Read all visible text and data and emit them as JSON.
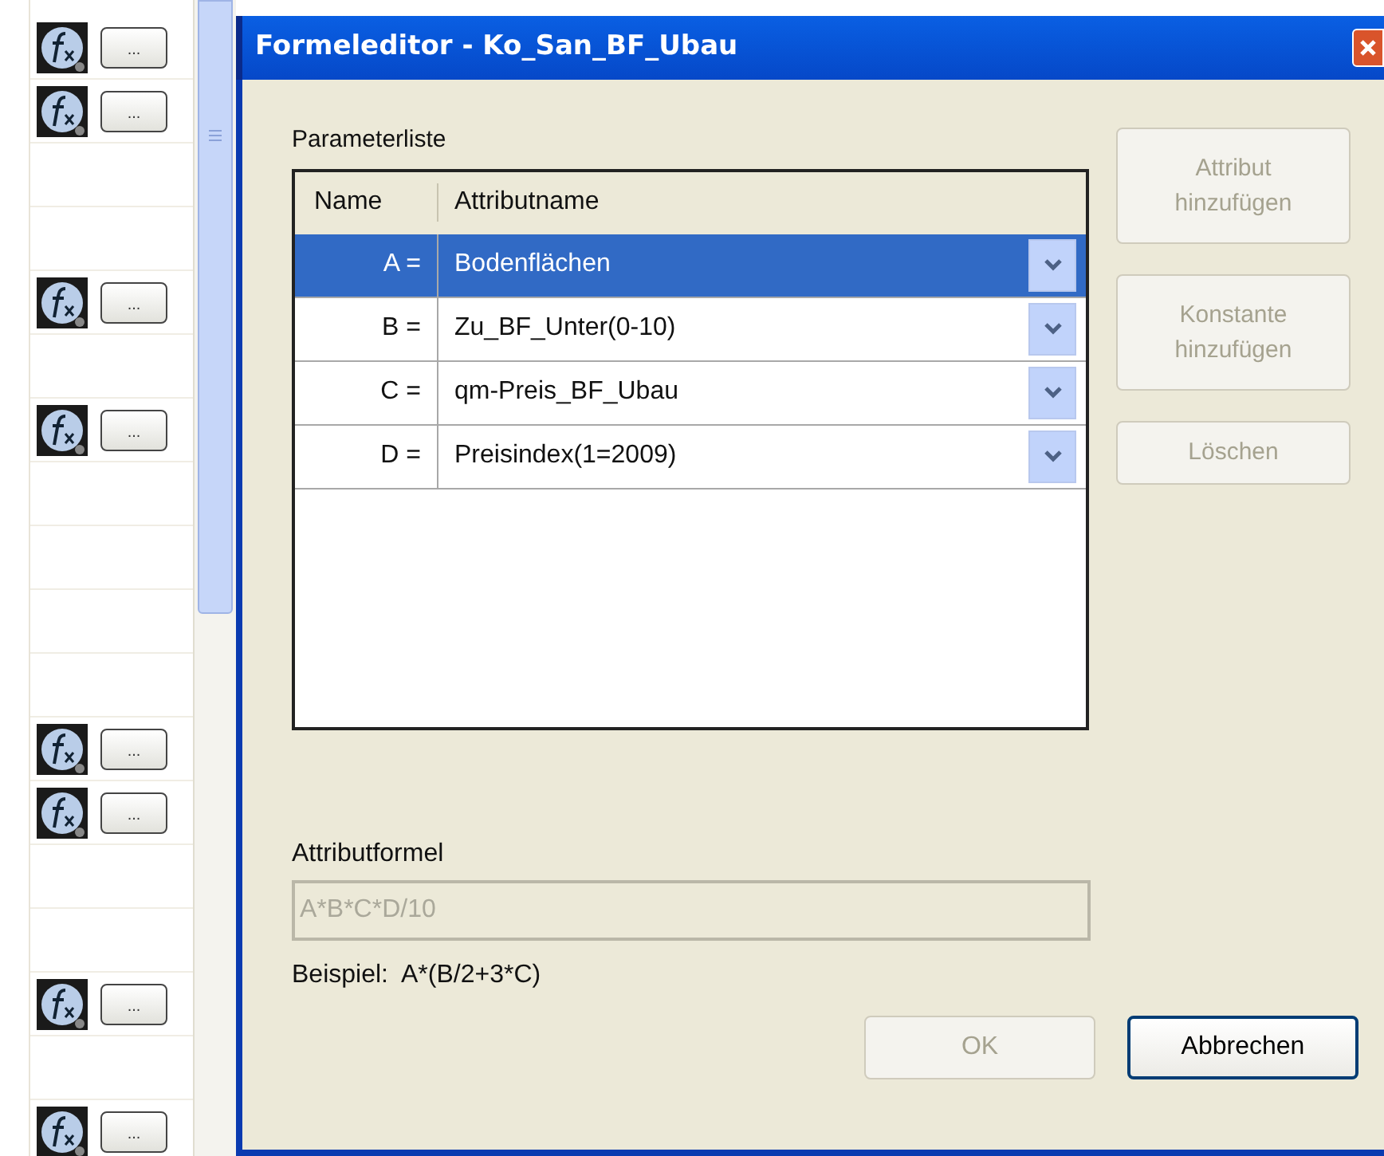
{
  "background_list": {
    "rows": [
      {
        "kind": "formula",
        "button_label": "..."
      },
      {
        "kind": "formula",
        "button_label": "..."
      },
      {
        "kind": "empty"
      },
      {
        "kind": "empty"
      },
      {
        "kind": "formula",
        "button_label": "..."
      },
      {
        "kind": "empty"
      },
      {
        "kind": "formula",
        "button_label": "..."
      },
      {
        "kind": "empty"
      },
      {
        "kind": "empty"
      },
      {
        "kind": "empty"
      },
      {
        "kind": "empty"
      },
      {
        "kind": "formula",
        "button_label": "..."
      },
      {
        "kind": "formula",
        "button_label": "..."
      },
      {
        "kind": "empty"
      },
      {
        "kind": "empty"
      },
      {
        "kind": "formula",
        "button_label": "..."
      },
      {
        "kind": "empty"
      },
      {
        "kind": "formula",
        "button_label": "..."
      }
    ]
  },
  "window": {
    "title": "Formeleditor - Ko_San_BF_Ubau"
  },
  "parameter_list": {
    "label": "Parameterliste",
    "columns": [
      "Name",
      "Attributname"
    ],
    "rows": [
      {
        "name": "A =",
        "attribute": "Bodenflächen",
        "selected": true
      },
      {
        "name": "B =",
        "attribute": "Zu_BF_Unter(0-10)",
        "selected": false
      },
      {
        "name": "C =",
        "attribute": "qm-Preis_BF_Ubau",
        "selected": false
      },
      {
        "name": "D =",
        "attribute": "Preisindex(1=2009)",
        "selected": false
      }
    ]
  },
  "side_buttons": [
    {
      "label": "Attribut hinzufügen",
      "disabled": true
    },
    {
      "label": "Konstante hinzufügen",
      "disabled": true
    },
    {
      "label": "Löschen",
      "disabled": true
    }
  ],
  "formula": {
    "label": "Attributformel",
    "value": "A*B*C*D/10",
    "disabled": true
  },
  "example": "Beispiel:  A*(B/2+3*C)",
  "buttons": [
    {
      "label": "OK",
      "disabled": true
    },
    {
      "label": "Abbrechen",
      "disabled": false
    }
  ]
}
